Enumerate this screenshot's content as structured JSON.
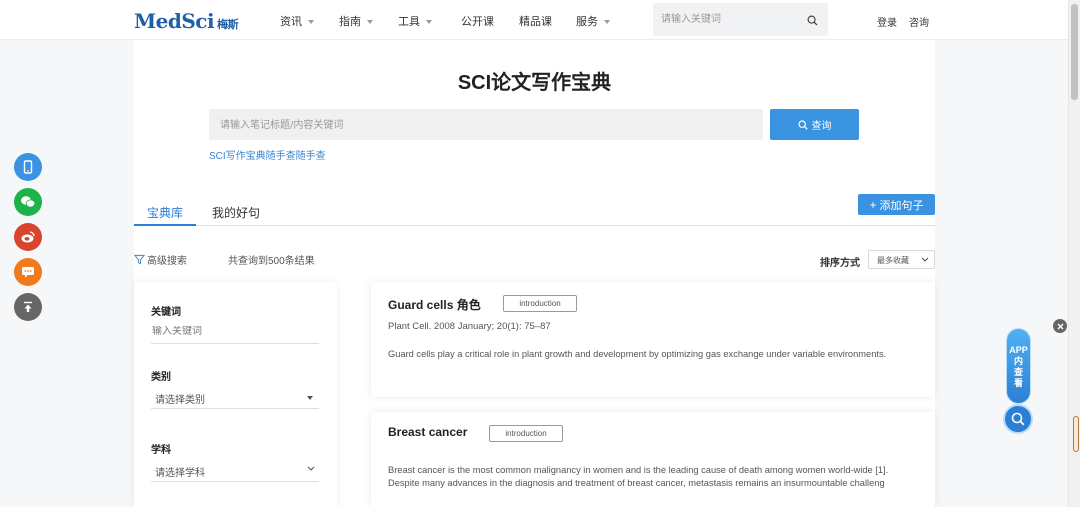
{
  "header": {
    "logo_text": "MedSci",
    "logo_cn": "梅斯",
    "nav": [
      {
        "label": "资讯",
        "dropdown": true
      },
      {
        "label": "指南",
        "dropdown": true
      },
      {
        "label": "工具",
        "dropdown": true
      },
      {
        "label": "公开课",
        "dropdown": false
      },
      {
        "label": "精品课",
        "dropdown": false
      },
      {
        "label": "服务",
        "dropdown": true
      }
    ],
    "search_placeholder": "请输入关键词",
    "login": "登录",
    "consult": "咨询"
  },
  "page": {
    "title": "SCI论文写作宝典",
    "search_placeholder": "请输入笔记标题/内容关键词",
    "query_button": "查询",
    "sub_link": "SCI写作宝典随手查随手查"
  },
  "tabs": [
    {
      "label": "宝典库",
      "active": true
    },
    {
      "label": "我的好句",
      "active": false
    }
  ],
  "add_button": "添加句子",
  "toolbar": {
    "advanced_search": "高级搜索",
    "result_count": "共查询到500条结果",
    "sort_label": "排序方式",
    "sort_value": "最多收藏"
  },
  "filters": {
    "keyword_label": "关键词",
    "keyword_placeholder": "输入关键词",
    "category_label": "类别",
    "category_value": "请选择类别",
    "subject_label": "学科",
    "subject_value": "请选择学科"
  },
  "results": [
    {
      "title": "Guard cells 角色",
      "tag": "introduction",
      "citation": "Plant Cell. 2008 January; 20(1): 75–87",
      "text": "Guard cells play a critical role in plant growth and development by optimizing gas exchange under variable environments."
    },
    {
      "title": "Breast cancer",
      "tag": "introduction",
      "citation": "",
      "text_line1": "Breast cancer is the most common malignancy in women and is the leading cause of death among women world-wide [1].",
      "text_line2": "Despite many advances in the diagnosis and treatment of breast cancer, metastasis remains an insurmountable challeng"
    }
  ],
  "app_widget": {
    "label_line1": "APP",
    "label_line2": "内",
    "label_line3": "查",
    "label_line4": "看"
  },
  "colors": {
    "accent": "#3a93e0",
    "tab_active": "#2c7fd6",
    "logo": "#1f5fa8",
    "float_phone": "#3a93e0",
    "float_wechat": "#1fb24a",
    "float_weibo": "#d9452c",
    "float_chat": "#f07a1c",
    "float_top": "#666666"
  }
}
